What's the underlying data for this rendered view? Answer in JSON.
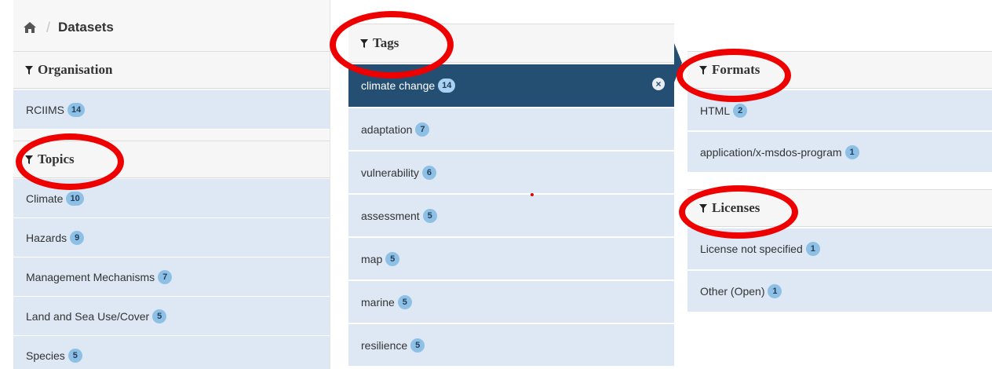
{
  "breadcrumb": {
    "current": "Datasets"
  },
  "organisation": {
    "heading": "Organisation",
    "items": [
      {
        "label": "RCIIMS",
        "count": "14"
      }
    ]
  },
  "topics": {
    "heading": "Topics",
    "items": [
      {
        "label": "Climate",
        "count": "10"
      },
      {
        "label": "Hazards",
        "count": "9"
      },
      {
        "label": "Management Mechanisms",
        "count": "7"
      },
      {
        "label": "Land and Sea Use/Cover",
        "count": "5"
      },
      {
        "label": "Species",
        "count": "5"
      }
    ]
  },
  "tags": {
    "heading": "Tags",
    "active": {
      "label": "climate change",
      "count": "14",
      "remove_glyph": "×"
    },
    "items": [
      {
        "label": "adaptation",
        "count": "7"
      },
      {
        "label": "vulnerability",
        "count": "6"
      },
      {
        "label": "assessment",
        "count": "5"
      },
      {
        "label": "map",
        "count": "5"
      },
      {
        "label": "marine",
        "count": "5"
      },
      {
        "label": "resilience",
        "count": "5"
      }
    ]
  },
  "formats": {
    "heading": "Formats",
    "items": [
      {
        "label": "HTML",
        "count": "2"
      },
      {
        "label": "application/x-msdos-program",
        "count": "1"
      }
    ]
  },
  "licenses": {
    "heading": "Licenses",
    "items": [
      {
        "label": "License not specified",
        "count": "1"
      },
      {
        "label": "Other (Open)",
        "count": "1"
      }
    ]
  },
  "icons": {
    "home": "home-icon",
    "filter": "filter-funnel-icon",
    "remove": "remove-filter-icon"
  },
  "colors": {
    "active_row": "#244f73",
    "row_bg": "#dde8f4",
    "badge": "#8ec0e6",
    "highlight_ring": "#ef0000"
  }
}
